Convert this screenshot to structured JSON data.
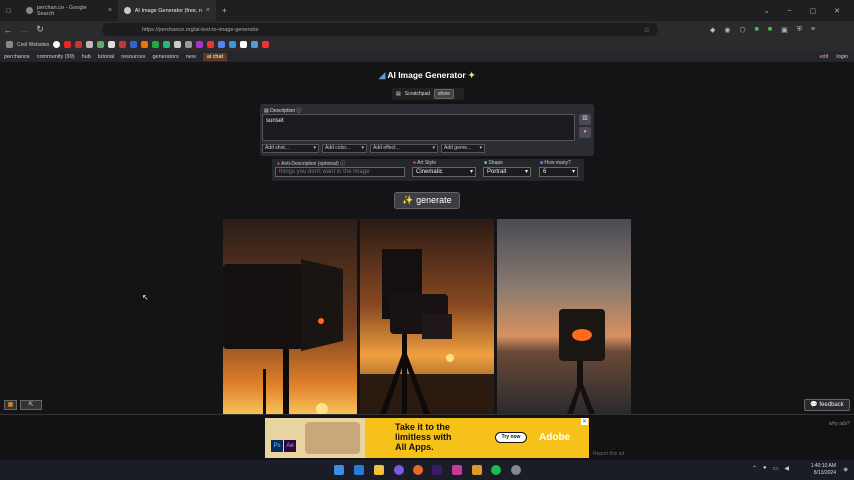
{
  "browser": {
    "tabs": [
      {
        "label": "perchan.ce - Google Search"
      },
      {
        "label": "AI Image Generator (free, no sign..."
      }
    ],
    "new_tab": "+",
    "url": "https://perchance.org/ai-text-to-image-generator",
    "bookmarks_label": "Cool Websites"
  },
  "sitenav": {
    "items": [
      "perchance",
      "community (99)",
      "hub",
      "tutorial",
      "resources",
      "generators",
      "new",
      "ai chat"
    ],
    "edit": "edit",
    "login": "login"
  },
  "app": {
    "title": "AI Image Generator",
    "scratchpad_label": "Scratchpad",
    "scratchpad_show": "show",
    "description_label": "Description",
    "description_value": "sunset",
    "add_shot": "Add shot...",
    "add_color": "Add color...",
    "add_effect": "Add effect...",
    "add_genre": "Add genre...",
    "anti_label": "Anti-Description (optional)",
    "anti_placeholder": "things you don't want in the image",
    "art_style_label": "Art Style",
    "art_style_value": "Cinematic",
    "shape_label": "Shape",
    "shape_value": "Portrait",
    "how_many_label": "How many?",
    "how_many_value": "6",
    "generate_label": "generate"
  },
  "feedback_label": "feedback",
  "ad": {
    "headline_line1": "Take it to the",
    "headline_line2": "limitless with",
    "headline_line3": "All Apps.",
    "cta": "Try now",
    "brand": "Adobe",
    "why_ads": "why ads?",
    "report": "Report this ad"
  },
  "taskbar": {
    "time": "1:40:10 AM",
    "date": "8/13/2024"
  }
}
